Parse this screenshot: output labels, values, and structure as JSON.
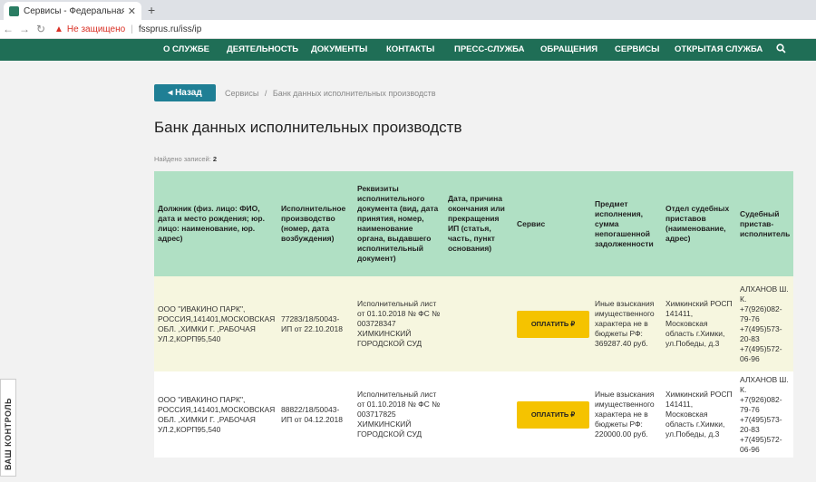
{
  "browser": {
    "tab_title": "Сервисы - Федеральная служб",
    "tab_close": "✕",
    "new_tab": "+",
    "insecure_label": "Не защищено",
    "url": "fssprus.ru/iss/ip"
  },
  "nav": {
    "items": [
      "О СЛУЖБЕ",
      "ДЕЯТЕЛЬНОСТЬ",
      "ДОКУМЕНТЫ",
      "КОНТАКТЫ",
      "ПРЕСС-СЛУЖБА",
      "ОБРАЩЕНИЯ",
      "СЕРВИСЫ",
      "ОТКРЫТАЯ СЛУЖБА"
    ]
  },
  "back_label": "◂ Назад",
  "breadcrumb": {
    "item1": "Сервисы",
    "sep": "/",
    "item2": "Банк данных исполнительных производств"
  },
  "page_title": "Банк данных исполнительных производств",
  "found": {
    "label": "Найдено записей:",
    "count": "2"
  },
  "table": {
    "headers": [
      "Должник (физ. лицо: ФИО, дата и место рождения; юр. лицо: наименование, юр. адрес)",
      "Исполнительное производство (номер, дата возбуждения)",
      "Реквизиты исполнительного документа (вид, дата принятия, номер, наименование органа, выдавшего исполнительный документ)",
      "Дата, причина окончания или прекращения ИП (статья, часть, пункт основания)",
      "Сервис",
      "Предмет исполнения, сумма непогашенной задолженности",
      "Отдел судебных приставов (наименование, адрес)",
      "Судебный пристав-исполнитель"
    ],
    "pay_label": "ОПЛАТИТЬ ₽",
    "rows": [
      {
        "debtor": "ООО \"ИВАКИНО ПАРК\", РОССИЯ,141401,МОСКОВСКАЯ ОБЛ. ,ХИМКИ Г. ,РАБОЧАЯ УЛ.2,КОРП95,540",
        "proceeding": "77283/18/50043-ИП от 22.10.2018",
        "document": "Исполнительный лист от 01.10.2018 № ФС № 003728347 ХИМКИНСКИЙ ГОРОДСКОЙ СУД",
        "end": "",
        "subject": "Иные взыскания имущественного характера не в бюджеты РФ: 369287.40 руб.",
        "department": "Химкинский РОСП 141411, Московская область г.Химки, ул.Победы, д.3",
        "bailiff": "АЛХАНОВ Ш. К. +7(926)082-79-76 +7(495)573-20-83 +7(495)572-06-96"
      },
      {
        "debtor": "ООО \"ИВАКИНО ПАРК\", РОССИЯ,141401,МОСКОВСКАЯ ОБЛ. ,ХИМКИ Г. ,РАБОЧАЯ УЛ.2,КОРП95,540",
        "proceeding": "88822/18/50043-ИП от 04.12.2018",
        "document": "Исполнительный лист от 01.10.2018 № ФС № 003717825 ХИМКИНСКИЙ ГОРОДСКОЙ СУД",
        "end": "",
        "subject": "Иные взыскания имущественного характера не в бюджеты РФ: 220000.00 руб.",
        "department": "Химкинский РОСП 141411, Московская область г.Химки, ул.Победы, д.3",
        "bailiff": "АЛХАНОВ Ш. К. +7(926)082-79-76 +7(495)573-20-83 +7(495)572-06-96"
      }
    ]
  },
  "side_widget": "ВАШ КОНТРОЛЬ"
}
